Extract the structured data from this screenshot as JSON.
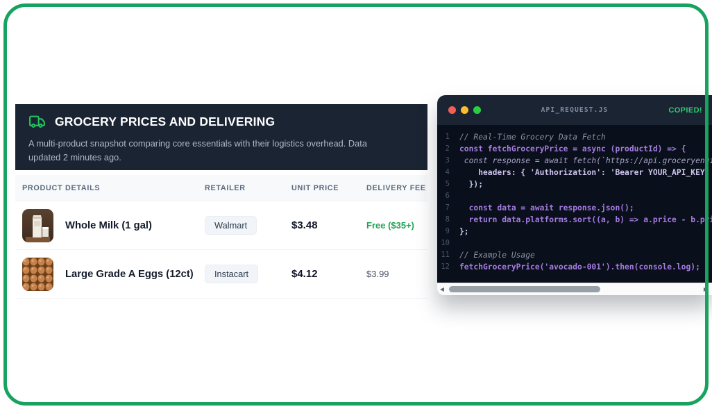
{
  "frame": {
    "border_color": "#17a35f"
  },
  "grocery_card": {
    "header": {
      "icon": "truck-icon",
      "title": "GROCERY PRICES AND DELIVERING",
      "subtitle": "A multi-product snapshot comparing core essentials with their logistics overhead. Data updated 2 minutes ago."
    },
    "table": {
      "columns": [
        "Product Details",
        "Retailer",
        "Unit Price",
        "Delivery Fee"
      ],
      "rows": [
        {
          "image": "milk-thumbnail",
          "product": "Whole Milk (1 gal)",
          "retailer": "Walmart",
          "unit_price": "$3.48",
          "delivery_fee": "Free ($35+)",
          "fee_type": "free"
        },
        {
          "image": "eggs-thumbnail",
          "product": "Large Grade A Eggs (12ct)",
          "retailer": "Instacart",
          "unit_price": "$4.12",
          "delivery_fee": "$3.99",
          "fee_type": "paid"
        }
      ]
    },
    "colors": {
      "header_bg": "#1a2433",
      "free_fee": "#1fa454"
    }
  },
  "code_window": {
    "titlebar": {
      "filename": "API_REQUEST.JS",
      "status_badge": "COPIED!",
      "traffic_lights": [
        "close",
        "minimize",
        "zoom"
      ]
    },
    "lines": [
      {
        "n": "1",
        "text": "// Real-Time Grocery Data Fetch",
        "style": "comment"
      },
      {
        "n": "2",
        "text": "const fetchGroceryPrice = async (productId) => {",
        "style": "keyword"
      },
      {
        "n": "3",
        "text": " const response = await fetch(`https://api.groceryengine.io/v",
        "style": "string"
      },
      {
        "n": "4",
        "text": "    headers: { 'Authorization': 'Bearer YOUR_API_KEY' }",
        "style": "plain"
      },
      {
        "n": "5",
        "text": "  });",
        "style": "plain"
      },
      {
        "n": "6",
        "text": "",
        "style": "plain"
      },
      {
        "n": "7",
        "text": "  const data = await response.json();",
        "style": "keyword"
      },
      {
        "n": "8",
        "text": "  return data.platforms.sort((a, b) => a.price - b.price);",
        "style": "keyword"
      },
      {
        "n": "9",
        "text": "};",
        "style": "plain"
      },
      {
        "n": "10",
        "text": "",
        "style": "plain"
      },
      {
        "n": "11",
        "text": "// Example Usage",
        "style": "comment"
      },
      {
        "n": "12",
        "text": "fetchGroceryPrice('avocado-001').then(console.log);",
        "style": "keyword"
      }
    ],
    "colors": {
      "code_bg": "#0a0f1c",
      "titlebar_bg": "#1a2433",
      "keyword": "#a57ce0",
      "plain": "#cdc5ec",
      "comment": "#8b90a0",
      "badge_green": "#2ecc71"
    }
  }
}
